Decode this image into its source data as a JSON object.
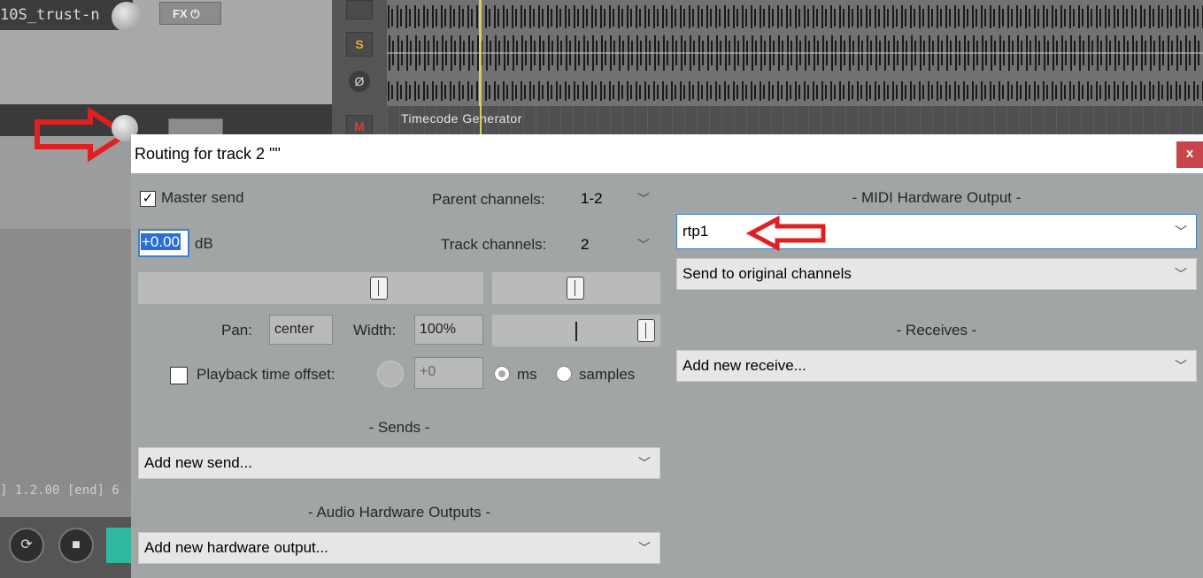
{
  "background": {
    "track1_name": "10S_trust-n",
    "fx_label": "FX",
    "solo_label": "S",
    "phase_label": "Ø",
    "mute_label": "M",
    "item2_name": "Timecode Generator",
    "position_readout": "] 1.2.00 [end] 6"
  },
  "dialog": {
    "title": "Routing for track 2 \"\"",
    "close_label": "x",
    "master_send_label": "Master send",
    "master_send_checked": true,
    "volume_value": "+0.00",
    "volume_unit": "dB",
    "parent_channels_label": "Parent channels:",
    "parent_channels_value": "1-2",
    "track_channels_label": "Track channels:",
    "track_channels_value": "2",
    "pan_label": "Pan:",
    "pan_value": "center",
    "width_label": "Width:",
    "width_value": "100%",
    "playback_offset_label": "Playback time offset:",
    "playback_offset_checked": false,
    "offset_value": "+0",
    "unit_ms_label": "ms",
    "unit_samples_label": "samples",
    "sends_header": "- Sends -",
    "sends_dropdown": "Add new send...",
    "audio_hw_header": "- Audio Hardware Outputs -",
    "audio_hw_dropdown": "Add new hardware output...",
    "midi_hw_header": "- MIDI Hardware Output -",
    "midi_device": "rtp1",
    "midi_channel_mode": "Send to original channels",
    "receives_header": "- Receives -",
    "receives_dropdown": "Add new receive..."
  },
  "colors": {
    "annotation_arrow": "#e02020",
    "dialog_bg": "#a2a5a6",
    "close_button": "#c8454b"
  }
}
